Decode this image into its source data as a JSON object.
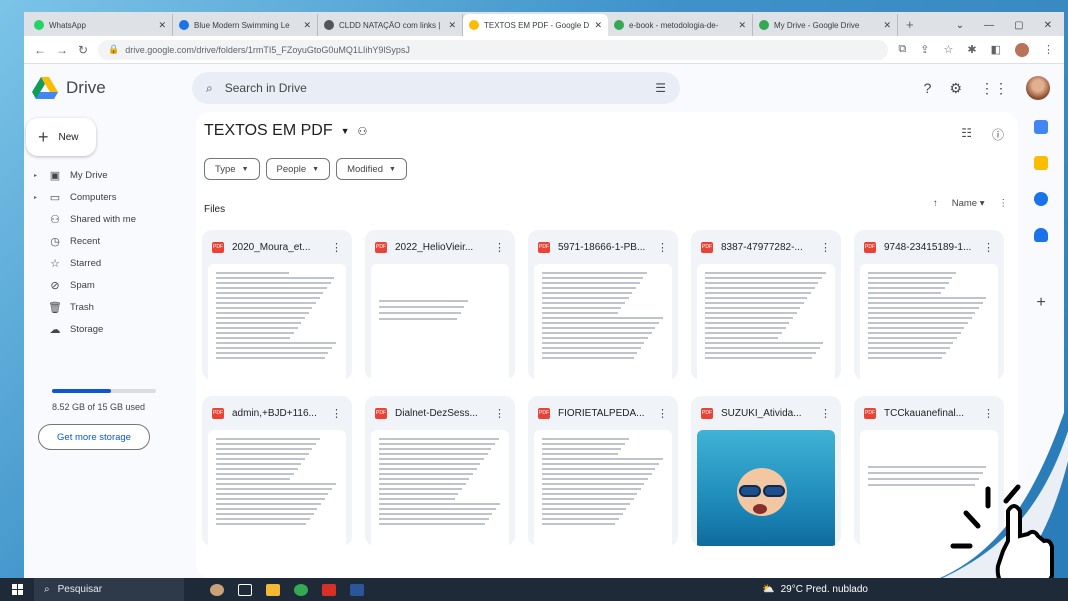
{
  "browser": {
    "tabs": [
      {
        "title": "WhatsApp",
        "color": "#25d366",
        "active": false
      },
      {
        "title": "Blue Modern Swimming Le",
        "color": "#1a73e8",
        "active": false
      },
      {
        "title": "CLDD NATAÇÃO com links |",
        "color": "#555555",
        "active": false
      },
      {
        "title": "TEXTOS EM PDF - Google D",
        "color": "#fbbc04",
        "active": true
      },
      {
        "title": "e-book - metodologia-de-",
        "color": "#34a853",
        "active": false
      },
      {
        "title": "My Drive - Google Drive",
        "color": "#34a853",
        "active": false
      }
    ],
    "url": "drive.google.com/drive/folders/1rmTI5_FZoyuGtoG0uMQ1LIihY9lSypsJ"
  },
  "drive": {
    "logo_text": "Drive",
    "search_placeholder": "Search in Drive",
    "new_label": "New",
    "nav": [
      {
        "label": "My Drive",
        "icon": "my-drive-icon",
        "glyph": "▣",
        "caret": true
      },
      {
        "label": "Computers",
        "icon": "computer-icon",
        "glyph": "▭",
        "caret": true
      },
      {
        "label": "Shared with me",
        "icon": "people-icon",
        "glyph": "⚇",
        "caret": false
      },
      {
        "label": "Recent",
        "icon": "clock-icon",
        "glyph": "◷",
        "caret": false
      },
      {
        "label": "Starred",
        "icon": "star-icon",
        "glyph": "☆",
        "caret": false
      },
      {
        "label": "Spam",
        "icon": "spam-icon",
        "glyph": "⊘",
        "caret": false
      },
      {
        "label": "Trash",
        "icon": "trash-icon",
        "glyph": "🗑",
        "caret": false
      },
      {
        "label": "Storage",
        "icon": "cloud-icon",
        "glyph": "☁",
        "caret": false
      }
    ],
    "storage_used_fraction": 0.57,
    "storage_text": "8.52 GB of 15 GB used",
    "get_storage_label": "Get more storage",
    "folder_title": "TEXTOS EM PDF",
    "filters": [
      "Type",
      "People",
      "Modified"
    ],
    "files_label": "Files",
    "sort_label": "Name",
    "files": [
      {
        "name": "2020_Moura_et..."
      },
      {
        "name": "2022_HelioVieir..."
      },
      {
        "name": "5971-18666-1-PB..."
      },
      {
        "name": "8387-47977282-..."
      },
      {
        "name": "9748-23415189-1..."
      },
      {
        "name": "admin,+BJD+116..."
      },
      {
        "name": "Dialnet-DezSess..."
      },
      {
        "name": "FIORIETALPEDA..."
      },
      {
        "name": "SUZUKI_Ativida..."
      },
      {
        "name": "TCCkauanefinal..."
      }
    ]
  },
  "taskbar": {
    "search_label": "Pesquisar",
    "weather": "29°C  Pred. nublado"
  }
}
